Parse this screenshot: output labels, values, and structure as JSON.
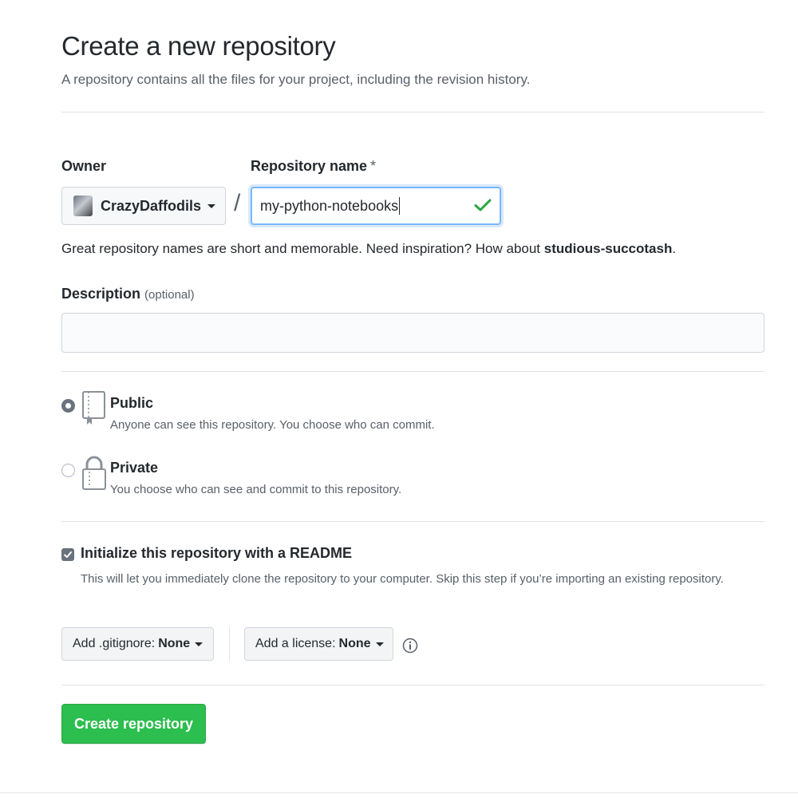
{
  "header": {
    "title": "Create a new repository",
    "subtitle": "A repository contains all the files for your project, including the revision history."
  },
  "owner": {
    "label": "Owner",
    "selected": "CrazyDaffodils"
  },
  "repo_name": {
    "label": "Repository name",
    "required_mark": "*",
    "value": "my-python-notebooks",
    "valid": true
  },
  "separator": "/",
  "hint": {
    "text": "Great repository names are short and memorable. Need inspiration? How about ",
    "suggestion": "studious-succotash",
    "end": "."
  },
  "description": {
    "label": "Description",
    "optional": "(optional)",
    "value": ""
  },
  "visibility": {
    "selected": "public",
    "public": {
      "title": "Public",
      "desc": "Anyone can see this repository. You choose who can commit."
    },
    "private": {
      "title": "Private",
      "desc": "You choose who can see and commit to this repository."
    }
  },
  "readme": {
    "checked": true,
    "title": "Initialize this repository with a README",
    "desc": "This will let you immediately clone the repository to your computer. Skip this step if you’re importing an existing repository."
  },
  "gitignore": {
    "label": "Add .gitignore:",
    "value": "None"
  },
  "license": {
    "label": "Add a license:",
    "value": "None"
  },
  "submit": {
    "label": "Create repository"
  },
  "colors": {
    "accent_green": "#2cbe4e",
    "check_green": "#28a745",
    "focus_blue": "#79b8ff"
  },
  "icons": {
    "check": "check-icon",
    "public": "repo-book-icon",
    "private": "lock-icon",
    "info": "info-icon"
  }
}
